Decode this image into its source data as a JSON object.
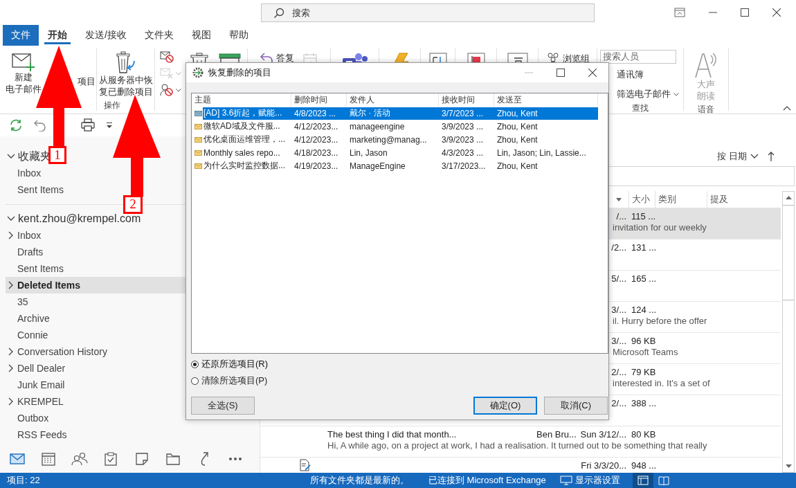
{
  "title_bar": {
    "search_placeholder": "搜索"
  },
  "ribbon": {
    "tabs": [
      {
        "label": "文件",
        "kind": "file",
        "selected": false
      },
      {
        "label": "开始",
        "kind": "tab",
        "selected": true
      },
      {
        "label": "发送/接收",
        "kind": "tab",
        "selected": false
      },
      {
        "label": "文件夹",
        "kind": "tab",
        "selected": false
      },
      {
        "label": "视图",
        "kind": "tab",
        "selected": false
      },
      {
        "label": "帮助",
        "kind": "tab",
        "selected": false
      }
    ],
    "sections": [
      {
        "items": [
          {
            "kind": "large",
            "label_lines": [
              "新建",
              "电子邮件"
            ],
            "disabled": false
          },
          {
            "kind": "large",
            "label_lines": [
              "项目"
            ],
            "disabled": false
          }
        ]
      },
      {
        "label": "操作",
        "items": [
          {
            "kind": "large",
            "label_lines": [
              "从服务器中恢",
              "复已删除项目"
            ],
            "disabled": false
          }
        ]
      },
      {
        "items": [
          {
            "kind": "stack",
            "rows": [
              {
                "caret": false,
                "disabled": false
              },
              {
                "caret": true,
                "disabled": true
              },
              {
                "caret": true,
                "disabled": false
              }
            ]
          },
          {
            "kind": "icon",
            "disabled": false
          },
          {
            "kind": "icon",
            "disabled": false
          }
        ]
      },
      {
        "items": [
          {
            "kind": "small",
            "label": "答复",
            "disabled": false
          },
          {
            "kind": "icon",
            "disabled": true
          }
        ]
      },
      {
        "items": [
          {
            "kind": "icon",
            "disabled": false
          }
        ]
      },
      {
        "items": [
          {
            "kind": "icon",
            "disabled": false
          }
        ]
      },
      {
        "items": [
          {
            "kind": "icon",
            "disabled": false
          }
        ]
      },
      {
        "items": [
          {
            "kind": "icon",
            "disabled": false
          }
        ]
      },
      {
        "items": [
          {
            "kind": "icon",
            "disabled": false
          }
        ]
      },
      {
        "items": [
          {
            "kind": "small",
            "label": "浏览组",
            "disabled": false
          }
        ]
      },
      {
        "label": "查找",
        "items": [
          {
            "kind": "field",
            "placeholder": "搜索人员"
          },
          {
            "kind": "text",
            "label": "通讯簿",
            "disabled": false
          },
          {
            "kind": "menu",
            "label": "筛选电子邮件",
            "disabled": false
          }
        ]
      },
      {
        "label": "语音",
        "items": [
          {
            "kind": "large",
            "label_lines": [
              "大声",
              "朗读"
            ],
            "disabled": true
          }
        ]
      }
    ]
  },
  "nav": {
    "favorites": {
      "label": "收藏夹",
      "expanded": true,
      "folders": [
        {
          "label": "Inbox",
          "has_children": false,
          "selected": false
        },
        {
          "label": "Sent Items",
          "has_children": false,
          "selected": false
        }
      ]
    },
    "account": {
      "label": "kent.zhou@krempel.com",
      "expanded": true,
      "folders": [
        {
          "label": "Inbox",
          "has_children": true,
          "selected": false
        },
        {
          "label": "Drafts",
          "has_children": false,
          "selected": false
        },
        {
          "label": "Sent Items",
          "has_children": false,
          "selected": false
        },
        {
          "label": "Deleted Items",
          "has_children": true,
          "selected": true
        },
        {
          "label": "35",
          "has_children": false,
          "selected": false
        },
        {
          "label": "Archive",
          "has_children": false,
          "selected": false
        },
        {
          "label": "Connie",
          "has_children": false,
          "selected": false
        },
        {
          "label": "Conversation History",
          "has_children": true,
          "selected": false
        },
        {
          "label": "Dell Dealer",
          "has_children": true,
          "selected": false
        },
        {
          "label": "Junk Email",
          "has_children": false,
          "selected": false
        },
        {
          "label": "KREMPEL",
          "has_children": true,
          "selected": false
        },
        {
          "label": "Outbox",
          "has_children": false,
          "selected": false
        },
        {
          "label": "RSS Feeds",
          "has_children": false,
          "selected": false
        }
      ]
    },
    "module_bar": [
      {
        "selected": true
      },
      {
        "selected": false
      },
      {
        "selected": false
      },
      {
        "selected": false
      },
      {
        "selected": false
      },
      {
        "selected": false
      },
      {
        "selected": false
      },
      {
        "selected": false
      }
    ]
  },
  "message_list": {
    "sort_label": "按 日期",
    "columns": [
      "大小",
      "类别",
      "提及"
    ],
    "rows": [
      {
        "kind": "clipped",
        "date": "/...",
        "size": "115 ...",
        "preview": "invitation for our weekly",
        "selected": true
      },
      {
        "kind": "clipped",
        "date": "/2...",
        "size": "131 ...",
        "selected": false
      },
      {
        "kind": "clipped",
        "date": "5/...",
        "size": "165 ...",
        "selected": false
      },
      {
        "kind": "clipped",
        "date": "3/...",
        "size": "124 ...",
        "preview": "il. Hurry before the offer",
        "selected": false
      },
      {
        "kind": "clipped",
        "date": "3/...",
        "size": "96 KB",
        "preview": "Microsoft Teams",
        "selected": false
      },
      {
        "kind": "clipped",
        "date": "2/...",
        "size": "79 KB",
        "preview": "interested in.  It's a set of",
        "selected": false
      },
      {
        "kind": "clipped",
        "date": "2/...",
        "size": "388 ...",
        "selected": false
      },
      {
        "kind": "full",
        "subject": "The best thing I did that month...",
        "sender": "Ben Bru...",
        "date": "Sun 3/12/...",
        "size": "80 KB",
        "preview": "Hi,  A while ago, on a project at work, I had a realisation.  It turned out to be something that really",
        "selected": false
      },
      {
        "kind": "draft",
        "date": "Fri 3/3/20...",
        "size": "948 ...",
        "selected": false
      }
    ]
  },
  "dialog": {
    "title": "恢复删除的项目",
    "columns": [
      "主题",
      "删除时间",
      "发件人",
      "接收时间",
      "发送至"
    ],
    "rows": [
      {
        "cells": [
          "[AD] 3.6折起，赋能...",
          "4/8/2023 ...",
          "戴尔 · 活动",
          "3/7/2023 ...",
          "Zhou, Kent"
        ],
        "selected": true
      },
      {
        "cells": [
          "微软AD域及文件服...",
          "4/12/2023...",
          "manageengine",
          "3/9/2023 ...",
          "Zhou, Kent"
        ],
        "selected": false
      },
      {
        "cells": [
          "优化桌面运维管理，...",
          "4/12/2023...",
          "marketing@manag...",
          "3/9/2023 ...",
          "Zhou, Kent"
        ],
        "selected": false
      },
      {
        "cells": [
          "Monthly sales repo...",
          "4/18/2023...",
          "Lin, Jason",
          "4/3/2023 ...",
          "Lin, Jason; Lin, Lassie..."
        ],
        "selected": false
      },
      {
        "cells": [
          "为什么实时监控数据...",
          "4/19/2023...",
          "ManageEngine",
          "3/17/2023...",
          "Zhou, Kent"
        ],
        "selected": false
      }
    ],
    "options": [
      {
        "label": "还原所选项目(R)",
        "selected": true
      },
      {
        "label": "清除所选项目(P)",
        "selected": false
      }
    ],
    "buttons": [
      {
        "label": "全选(S)",
        "kind": "left",
        "default": false
      },
      {
        "label": "确定(O)",
        "kind": "right",
        "default": true
      },
      {
        "label": "取消(C)",
        "kind": "right",
        "default": false
      }
    ]
  },
  "status_bar": {
    "items_count": "项目: 22",
    "sync": "所有文件夹都是最新的。",
    "connection": "已连接到 Microsoft Exchange",
    "display_settings": "显示器设置",
    "views": [
      {
        "selected": true
      },
      {
        "selected": false
      }
    ]
  },
  "annotations": [
    {
      "label": "1"
    },
    {
      "label": "2"
    }
  ]
}
